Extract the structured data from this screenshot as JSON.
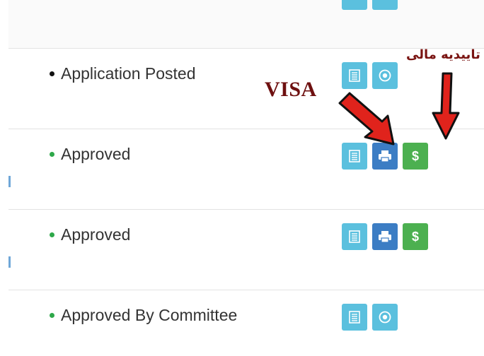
{
  "rows": [
    {
      "status": "Application Posted",
      "dot": "black",
      "buttons": [
        "details",
        "info"
      ]
    },
    {
      "status": "Approved",
      "dot": "green",
      "buttons": [
        "details",
        "print",
        "payment"
      ]
    },
    {
      "status": "Approved",
      "dot": "green",
      "buttons": [
        "details",
        "print",
        "payment"
      ]
    },
    {
      "status": "Approved By Committee",
      "dot": "green",
      "buttons": [
        "details",
        "info"
      ]
    }
  ],
  "annotations": {
    "visa": "VISA",
    "financial_confirmation": "تاییدیه مالی"
  },
  "payment_symbol": "$",
  "colors": {
    "info": "#5bc0de",
    "primary": "#3c7dc4",
    "success": "#4cb050",
    "arrow": "#e0231c"
  }
}
